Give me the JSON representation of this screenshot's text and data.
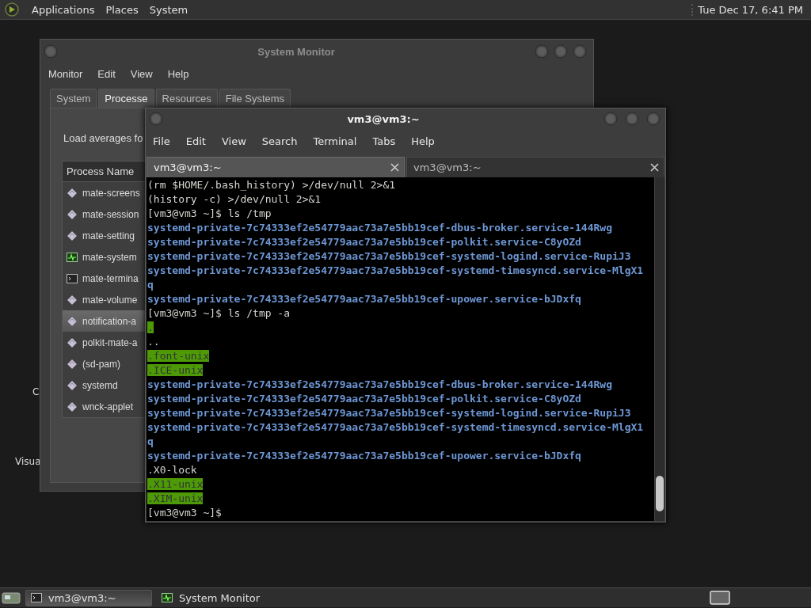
{
  "top_panel": {
    "menus": [
      "Applications",
      "Places",
      "System"
    ],
    "clock": "Tue Dec 17, 6:41 PM"
  },
  "desktop_icons": [
    {
      "label": "C"
    },
    {
      "label": "Visua"
    }
  ],
  "system_monitor": {
    "title": "System Monitor",
    "menu": [
      "Monitor",
      "Edit",
      "View",
      "Help"
    ],
    "tabs": [
      {
        "label": "System",
        "selected": false
      },
      {
        "label": "Processe",
        "selected": true
      },
      {
        "label": "Resources",
        "selected": false
      },
      {
        "label": "File Systems",
        "selected": false
      }
    ],
    "load_averages": "Load averages fo",
    "column": "Process Name",
    "processes": [
      {
        "name": "mate-screens",
        "kind": "service",
        "selected": false
      },
      {
        "name": "mate-session",
        "kind": "service",
        "selected": false
      },
      {
        "name": "mate-setting",
        "kind": "service",
        "selected": false
      },
      {
        "name": "mate-system",
        "kind": "monitor",
        "selected": false
      },
      {
        "name": "mate-termina",
        "kind": "terminal",
        "selected": false
      },
      {
        "name": "mate-volume",
        "kind": "service",
        "selected": false
      },
      {
        "name": "notification-a",
        "kind": "service",
        "selected": true
      },
      {
        "name": "polkit-mate-a",
        "kind": "service",
        "selected": false
      },
      {
        "name": "(sd-pam)",
        "kind": "service",
        "selected": false
      },
      {
        "name": "systemd",
        "kind": "service",
        "selected": false
      },
      {
        "name": "wnck-applet",
        "kind": "service",
        "selected": false
      }
    ]
  },
  "terminal": {
    "title": "vm3@vm3:~",
    "menu": [
      "File",
      "Edit",
      "View",
      "Search",
      "Terminal",
      "Tabs",
      "Help"
    ],
    "tabs": [
      {
        "label": "vm3@vm3:~",
        "selected": true
      },
      {
        "label": "vm3@vm3:~",
        "selected": false
      }
    ],
    "lines": [
      {
        "text": "(rm $HOME/.bash_history) >/dev/null 2>&1",
        "kind": "plain"
      },
      {
        "text": "(history -c) >/dev/null 2>&1",
        "kind": "plain"
      },
      {
        "text": "[vm3@vm3 ~]$ ls /tmp",
        "kind": "plain"
      },
      {
        "text": "systemd-private-7c74333ef2e54779aac73a7e5bb19cef-dbus-broker.service-144Rwg",
        "kind": "dir"
      },
      {
        "text": "systemd-private-7c74333ef2e54779aac73a7e5bb19cef-polkit.service-C8yOZd",
        "kind": "dir"
      },
      {
        "text": "systemd-private-7c74333ef2e54779aac73a7e5bb19cef-systemd-logind.service-RupiJ3",
        "kind": "dir"
      },
      {
        "text": "systemd-private-7c74333ef2e54779aac73a7e5bb19cef-systemd-timesyncd.service-MlgX1",
        "kind": "dir"
      },
      {
        "text": "q",
        "kind": "dir"
      },
      {
        "text": "systemd-private-7c74333ef2e54779aac73a7e5bb19cef-upower.service-bJDxfq",
        "kind": "dir"
      },
      {
        "text": "[vm3@vm3 ~]$ ls /tmp -a",
        "kind": "plain"
      },
      {
        "text": ".",
        "kind": "sticky"
      },
      {
        "text": "..",
        "kind": "plain"
      },
      {
        "text": ".font-unix",
        "kind": "sticky"
      },
      {
        "text": ".ICE-unix",
        "kind": "sticky"
      },
      {
        "text": "systemd-private-7c74333ef2e54779aac73a7e5bb19cef-dbus-broker.service-144Rwg",
        "kind": "dir"
      },
      {
        "text": "systemd-private-7c74333ef2e54779aac73a7e5bb19cef-polkit.service-C8yOZd",
        "kind": "dir"
      },
      {
        "text": "systemd-private-7c74333ef2e54779aac73a7e5bb19cef-systemd-logind.service-RupiJ3",
        "kind": "dir"
      },
      {
        "text": "systemd-private-7c74333ef2e54779aac73a7e5bb19cef-systemd-timesyncd.service-MlgX1",
        "kind": "dir"
      },
      {
        "text": "q",
        "kind": "dir"
      },
      {
        "text": "systemd-private-7c74333ef2e54779aac73a7e5bb19cef-upower.service-bJDxfq",
        "kind": "dir"
      },
      {
        "text": ".X0-lock",
        "kind": "plain"
      },
      {
        "text": ".X11-unix",
        "kind": "sticky"
      },
      {
        "text": ".XIM-unix",
        "kind": "sticky"
      },
      {
        "text": "[vm3@vm3 ~]$",
        "kind": "plain"
      }
    ]
  },
  "taskbar": {
    "tasks": [
      {
        "label": "vm3@vm3:~",
        "kind": "terminal",
        "selected": true
      },
      {
        "label": "System Monitor",
        "kind": "monitor",
        "selected": false
      }
    ]
  }
}
